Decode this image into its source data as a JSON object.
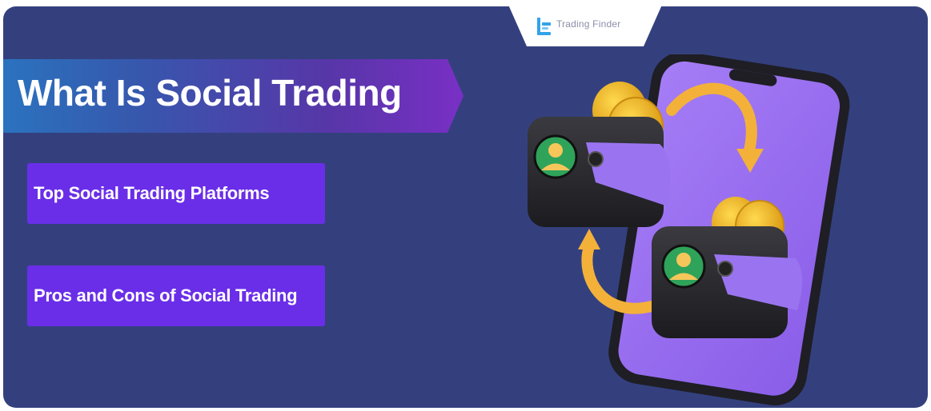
{
  "brand": {
    "name": "Trading Finder",
    "icon": "trading-finder-logo-icon"
  },
  "title": "What Is Social Trading",
  "buttons": [
    {
      "label": "Top Social Trading Platforms"
    },
    {
      "label": "Pros and Cons of Social Trading"
    }
  ],
  "colors": {
    "background": "#34407e",
    "pill": "#6a2ee8",
    "phone_screen": "#9a72f2",
    "wallet": "#2c2c30",
    "coin": "#f2b720",
    "arrow": "#f3b13a",
    "avatar_bg": "#2fa35a"
  },
  "illustration": {
    "icon": "social-trading-phone-wallets-illustration"
  }
}
